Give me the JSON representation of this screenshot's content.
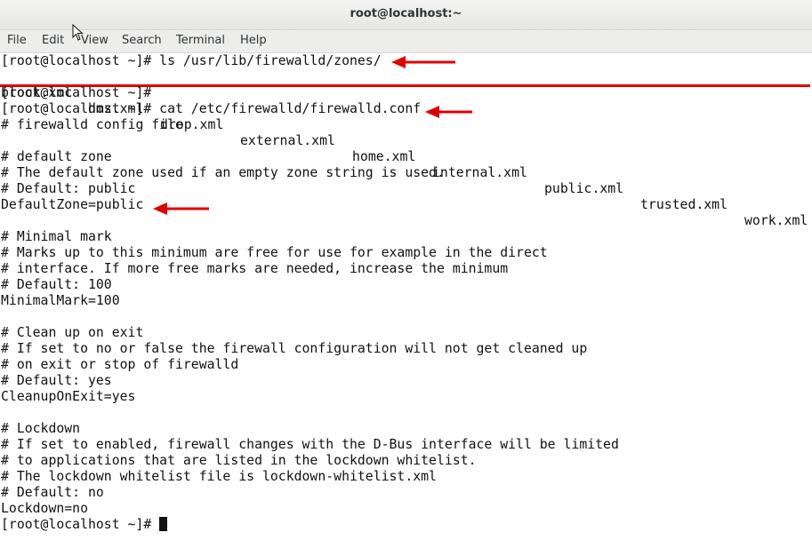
{
  "window": {
    "title": "root@localhost:~"
  },
  "menu": [
    "File",
    "Edit",
    "View",
    "Search",
    "Terminal",
    "Help"
  ],
  "terminal": {
    "cmd1": "[root@localhost ~]# ls /usr/lib/firewalld/zones/",
    "zones": [
      "block.xml",
      "dmz.xml",
      "drop.xml",
      "external.xml",
      "home.xml",
      "internal.xml",
      "public.xml",
      "trusted.xml",
      "work.xml"
    ],
    "prompt_empty": "[root@localhost ~]#",
    "cmd2": "[root@localhost ~]# cat /etc/firewalld/firewalld.conf",
    "conf_lines": [
      "# firewalld config file",
      "",
      "# default zone",
      "# The default zone used if an empty zone string is used.",
      "# Default: public",
      "DefaultZone=public",
      "",
      "# Minimal mark",
      "# Marks up to this minimum are free for use for example in the direct",
      "# interface. If more free marks are needed, increase the minimum",
      "# Default: 100",
      "MinimalMark=100",
      "",
      "# Clean up on exit",
      "# If set to no or false the firewall configuration will not get cleaned up",
      "# on exit or stop of firewalld",
      "# Default: yes",
      "CleanupOnExit=yes",
      "",
      "# Lockdown",
      "# If set to enabled, firewall changes with the D-Bus interface will be limited",
      "# to applications that are listed in the lockdown whitelist.",
      "# The lockdown whitelist file is lockdown-whitelist.xml",
      "# Default: no",
      "Lockdown=no"
    ],
    "final_prompt": "[root@localhost ~]# "
  },
  "annotation_color": "#e00000",
  "icons": {
    "pointer": "mouse-pointer-icon",
    "arrow": "red-arrow-icon"
  }
}
